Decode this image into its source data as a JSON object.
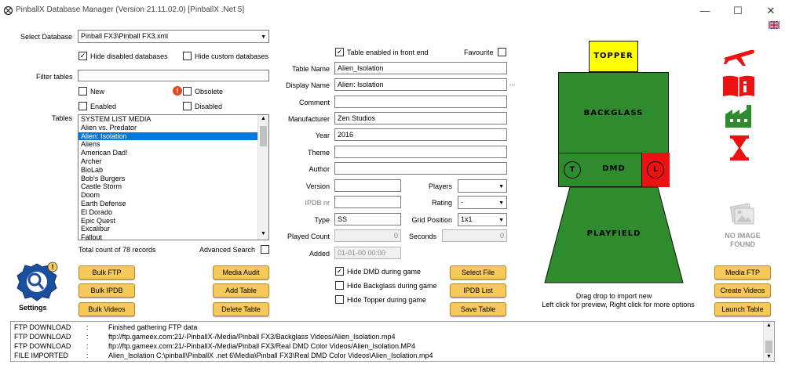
{
  "window": {
    "title": "PinballX Database Manager (Version 21.11.02.0)    [PinballX .Net 5]",
    "minimize": "—",
    "maximize": "☐",
    "close": "✕"
  },
  "left": {
    "select_db_label": "Select Database",
    "select_db_value": "Pinball FX3\\Pinball FX3.xml",
    "hide_disabled_label": "Hide disabled databases",
    "hide_disabled_checked": "✓",
    "hide_custom_label": "Hide custom databases",
    "filter_label": "Filter tables",
    "filter_value": "",
    "new_label": "New",
    "obsolete_label": "Obsolete",
    "enabled_label": "Enabled",
    "disabled_label": "Disabled",
    "tables_label": "Tables",
    "tables": [
      "SYSTEM LIST MEDIA",
      "Alien vs. Predator",
      "Alien: Isolation",
      "Aliens",
      "American Dad!",
      "Archer",
      "BioLab",
      "Bob's Burgers",
      "Castle Storm",
      "Doom",
      "Earth Defense",
      "El Dorado",
      "Epic Quest",
      "Excalibur",
      "Fallout"
    ],
    "total_count": "Total count of 78 records",
    "advanced_search": "Advanced Search",
    "settings_label": "Settings"
  },
  "buttons": {
    "bulk_ftp": "Bulk FTP",
    "bulk_ipdb": "Bulk IPDB",
    "bulk_videos": "Bulk Videos",
    "media_audit": "Media Audit",
    "add_table": "Add Table",
    "delete_table": "Delete Table",
    "select_file": "Select File",
    "ipdb_list": "IPDB List",
    "save_table": "Save Table",
    "media_ftp": "Media FTP",
    "create_videos": "Create Videos",
    "launch_table": "Launch Table"
  },
  "form": {
    "enabled_front_end_label": "Table enabled in front end",
    "enabled_front_end_checked": "✓",
    "favourite_label": "Favourite",
    "table_name_label": "Table Name",
    "table_name": "Alien_Isolation",
    "display_name_label": "Display Name",
    "display_name": "Alien: Isolation",
    "ellipsis": "...",
    "comment_label": "Comment",
    "comment": "",
    "manufacturer_label": "Manufacturer",
    "manufacturer": "Zen Studios",
    "year_label": "Year",
    "year": "2016",
    "theme_label": "Theme",
    "theme": "",
    "author_label": "Author",
    "author": "",
    "version_label": "Version",
    "version": "",
    "players_label": "Players",
    "players": "",
    "ipdb_label": "IPDB nr",
    "ipdb": "",
    "rating_label": "Rating",
    "rating": "-",
    "type_label": "Type",
    "type": "SS",
    "grid_label": "Grid Position",
    "grid": "1x1",
    "played_label": "Played Count",
    "played": "0",
    "seconds_label": "Seconds",
    "seconds": "0",
    "added_label": "Added",
    "added": "01-01-00 00:00",
    "hide_dmd_label": "Hide DMD during game",
    "hide_dmd_checked": "✓",
    "hide_backglass_label": "Hide Backglass during game",
    "hide_topper_label": "Hide Topper during game"
  },
  "cabinet": {
    "topper": "TOPPER",
    "backglass": "BACKGLASS",
    "dmd": "DMD",
    "t": "T",
    "l": "L",
    "playfield": "PLAYFIELD",
    "hint_line1": "Drag drop to import new",
    "hint_line2": "Left click for preview, Right click for more options",
    "no_image_line1": "NO IMAGE",
    "no_image_line2": "FOUND",
    "colors": {
      "green": "#2e8b2e",
      "yellow": "#ffff00",
      "red": "#ee1111"
    }
  },
  "log": [
    {
      "type": "FTP DOWNLOAD",
      "sep": ":",
      "detail": "Finished gathering FTP data"
    },
    {
      "type": "FTP DOWNLOAD",
      "sep": ":",
      "detail": "ftp://ftp.gameex.com:21/-PinballX-/Media/Pinball FX3/Backglass Videos/Alien_Isolation.mp4"
    },
    {
      "type": "FTP DOWNLOAD",
      "sep": ":",
      "detail": "ftp://ftp.gameex.com:21/-PinballX-/Media/Pinball FX3/Real DMD Color Videos/Alien_Isolation.MP4"
    },
    {
      "type": "FILE IMPORTED",
      "sep": ":",
      "detail": "Alien_Isolation           C:\\pinball\\PinballX .net 6\\Media\\Pinball FX3\\Real DMD Color Videos\\Alien_Isolation.mp4"
    }
  ]
}
